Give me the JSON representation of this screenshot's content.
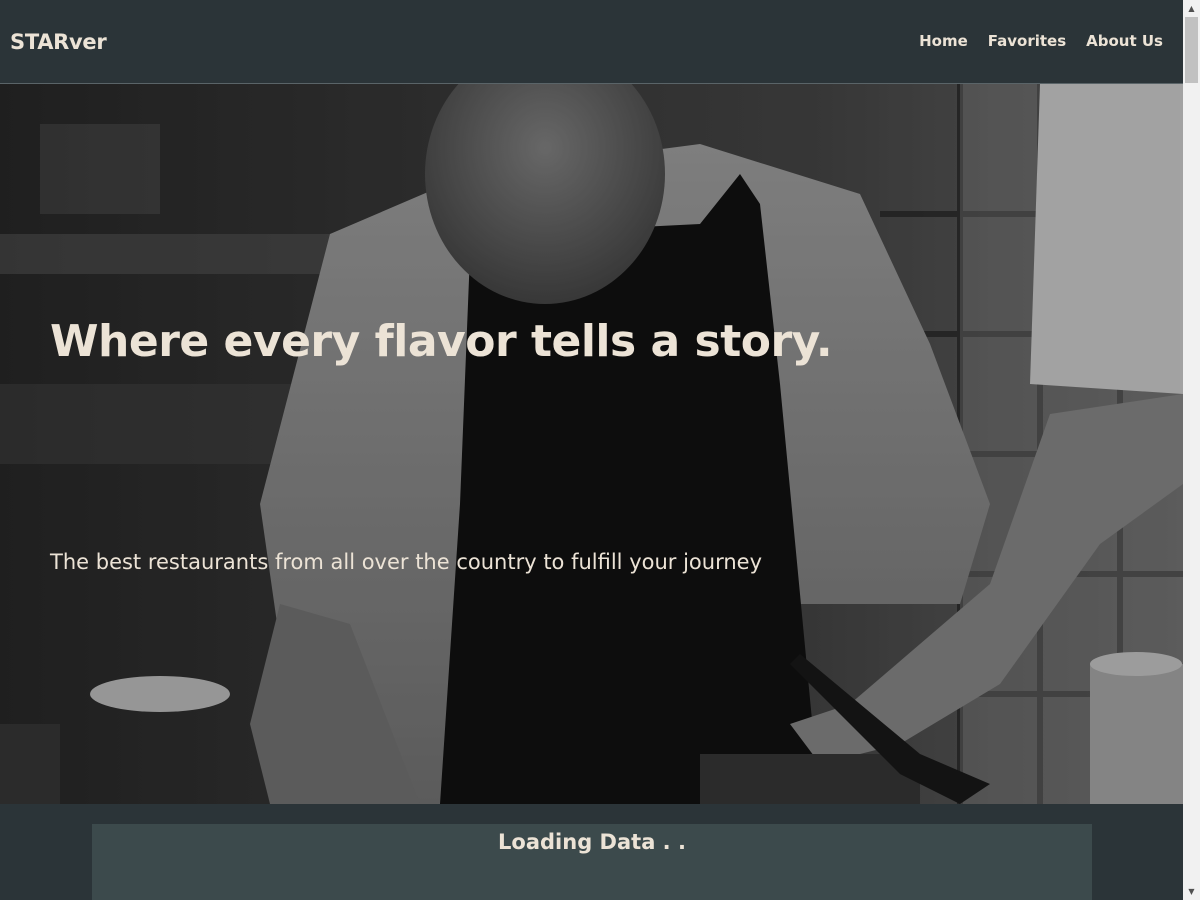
{
  "header": {
    "logo": "STARver",
    "nav": [
      {
        "label": "Home"
      },
      {
        "label": "Favorites"
      },
      {
        "label": "About Us"
      }
    ]
  },
  "hero": {
    "title": "Where every flavor tells a story.",
    "subtitle": "The best restaurants from all over the country to fulfill your journey",
    "image": "chef-kitchen-photo"
  },
  "content": {
    "loading_text": "Loading Data . ."
  },
  "colors": {
    "background": "#2b3438",
    "text": "#ece3d6",
    "panel": "#3c4a4c"
  },
  "icons": {
    "scroll_up": "triangle-up-icon",
    "scroll_down": "triangle-down-icon"
  }
}
